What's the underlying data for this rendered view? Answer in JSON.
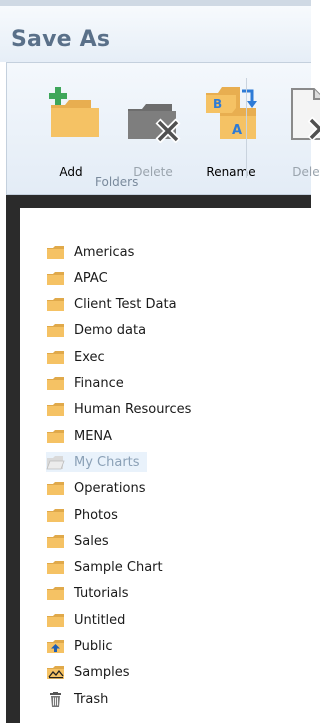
{
  "window": {
    "title": "Save As"
  },
  "toolbar": {
    "add_label": "Add",
    "delete_label": "Delete",
    "rename_label": "Rename",
    "delete2_label": "Delete",
    "group_label": "Folders"
  },
  "colors": {
    "folder": "#f5c264",
    "folder_dark": "#e0a94a",
    "accent": "#2e7bd6",
    "plus_green": "#3ea65a",
    "selected_bg": "#e9f2fb"
  },
  "folders": [
    {
      "label": "Americas",
      "icon": "folder-icon"
    },
    {
      "label": "APAC",
      "icon": "folder-icon"
    },
    {
      "label": "Client Test Data",
      "icon": "folder-icon"
    },
    {
      "label": "Demo data",
      "icon": "folder-icon"
    },
    {
      "label": "Exec",
      "icon": "folder-icon"
    },
    {
      "label": "Finance",
      "icon": "folder-icon"
    },
    {
      "label": "Human Resources",
      "icon": "folder-icon"
    },
    {
      "label": "MENA",
      "icon": "folder-icon"
    },
    {
      "label": "My Charts",
      "icon": "open-folder-icon",
      "selected": true
    },
    {
      "label": "Operations",
      "icon": "folder-icon"
    },
    {
      "label": "Photos",
      "icon": "folder-icon"
    },
    {
      "label": "Sales",
      "icon": "folder-icon"
    },
    {
      "label": "Sample Chart",
      "icon": "folder-icon"
    },
    {
      "label": "Tutorials",
      "icon": "folder-icon"
    },
    {
      "label": "Untitled",
      "icon": "folder-icon"
    },
    {
      "label": "Public",
      "icon": "public-folder-icon"
    },
    {
      "label": "Samples",
      "icon": "samples-folder-icon"
    },
    {
      "label": "Trash",
      "icon": "trash-icon"
    }
  ]
}
